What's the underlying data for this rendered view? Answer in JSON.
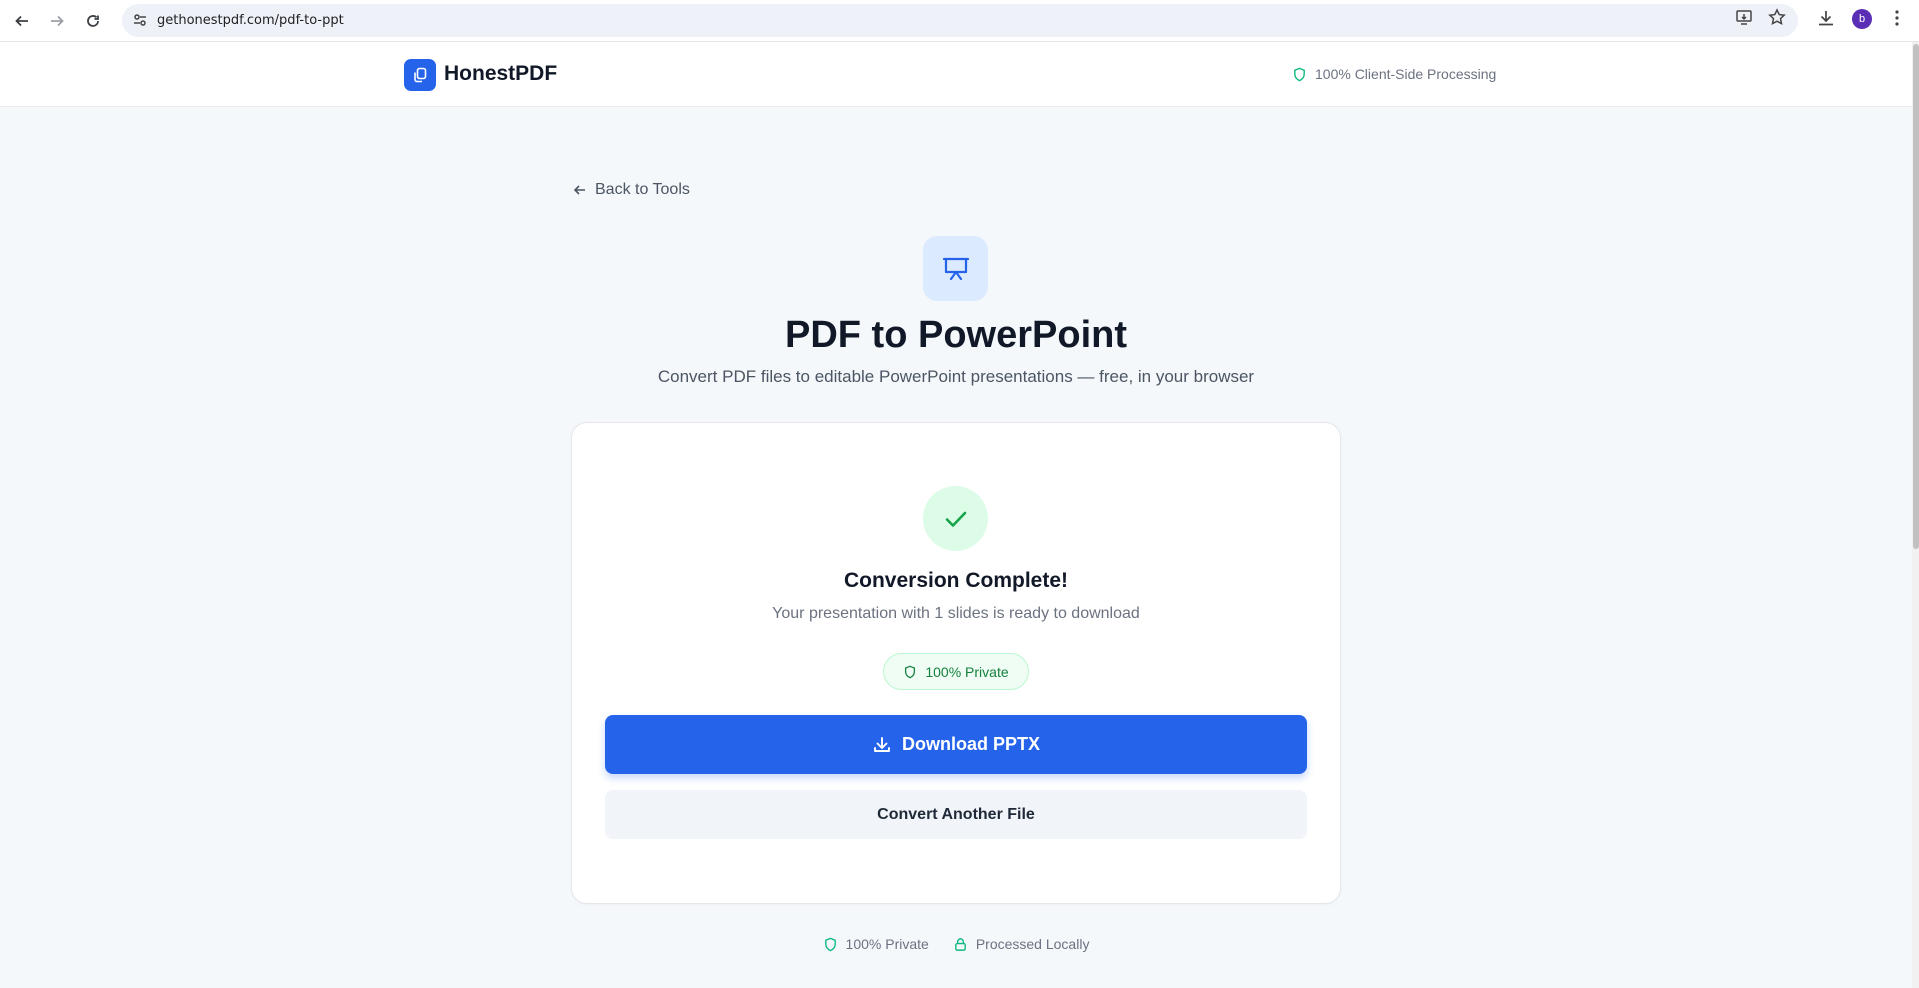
{
  "browser": {
    "url": "gethonestpdf.com/pdf-to-ppt",
    "profile_initial": "b"
  },
  "header": {
    "brand": "HonestPDF",
    "badge": "100% Client-Side Processing"
  },
  "main": {
    "back_label": "Back to Tools",
    "title": "PDF to PowerPoint",
    "subtitle": "Convert PDF files to editable PowerPoint presentations — free, in your browser"
  },
  "result": {
    "heading": "Conversion Complete!",
    "message": "Your presentation with 1 slides is ready to download",
    "badge": "100% Private",
    "download_label": "Download PPTX",
    "another_label": "Convert Another File"
  },
  "footer": {
    "private": "100% Private",
    "local": "Processed Locally"
  },
  "colors": {
    "accent": "#2563eb",
    "success": "#16a34a",
    "success_bg": "#dcfce7"
  }
}
